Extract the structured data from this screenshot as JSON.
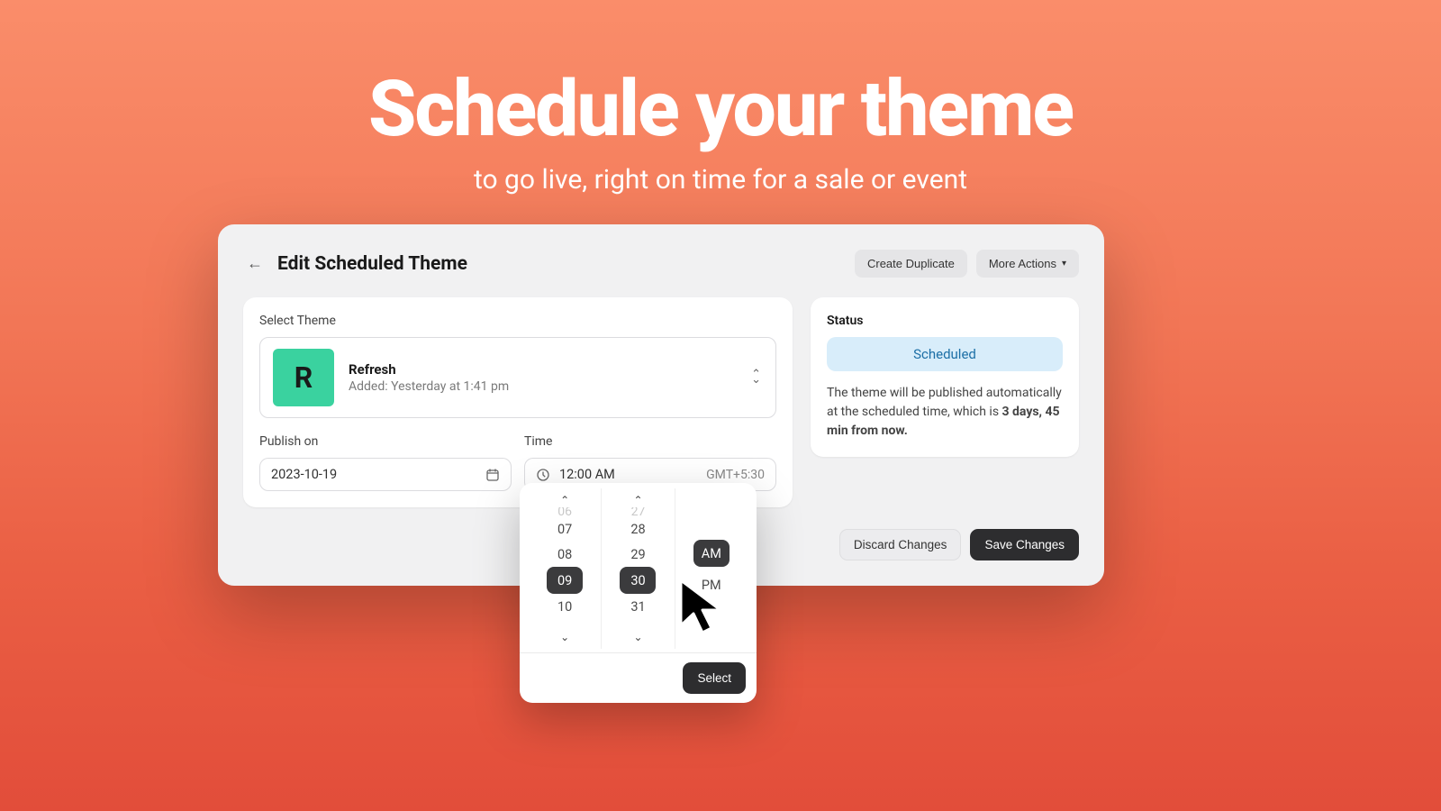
{
  "hero": {
    "title": "Schedule your theme",
    "subtitle": "to go live, right on time for a sale or event"
  },
  "header": {
    "page_title": "Edit Scheduled Theme",
    "duplicate_label": "Create Duplicate",
    "more_actions_label": "More Actions"
  },
  "theme": {
    "section_label": "Select Theme",
    "thumb_letter": "R",
    "name": "Refresh",
    "added_line": "Added: Yesterday at 1:41 pm"
  },
  "date": {
    "label": "Publish on",
    "value": "2023-10-19"
  },
  "time": {
    "label": "Time",
    "value": "12:00 AM",
    "tz": "GMT+5:30"
  },
  "status": {
    "label": "Status",
    "badge": "Scheduled",
    "text_prefix": "The theme will be published automatically at the scheduled time, which is ",
    "bold_part": "3 days, 45 min from now."
  },
  "footer": {
    "discard_label": "Discard Changes",
    "save_label": "Save Changes"
  },
  "picker": {
    "hours": [
      "07",
      "08",
      "09",
      "10"
    ],
    "hours_partial_top": "06",
    "minutes": [
      "28",
      "29",
      "30",
      "31"
    ],
    "minutes_partial_top": "27",
    "ampm": [
      "AM",
      "PM"
    ],
    "selected_hour": "09",
    "selected_minute": "30",
    "selected_ampm": "AM",
    "select_label": "Select"
  }
}
